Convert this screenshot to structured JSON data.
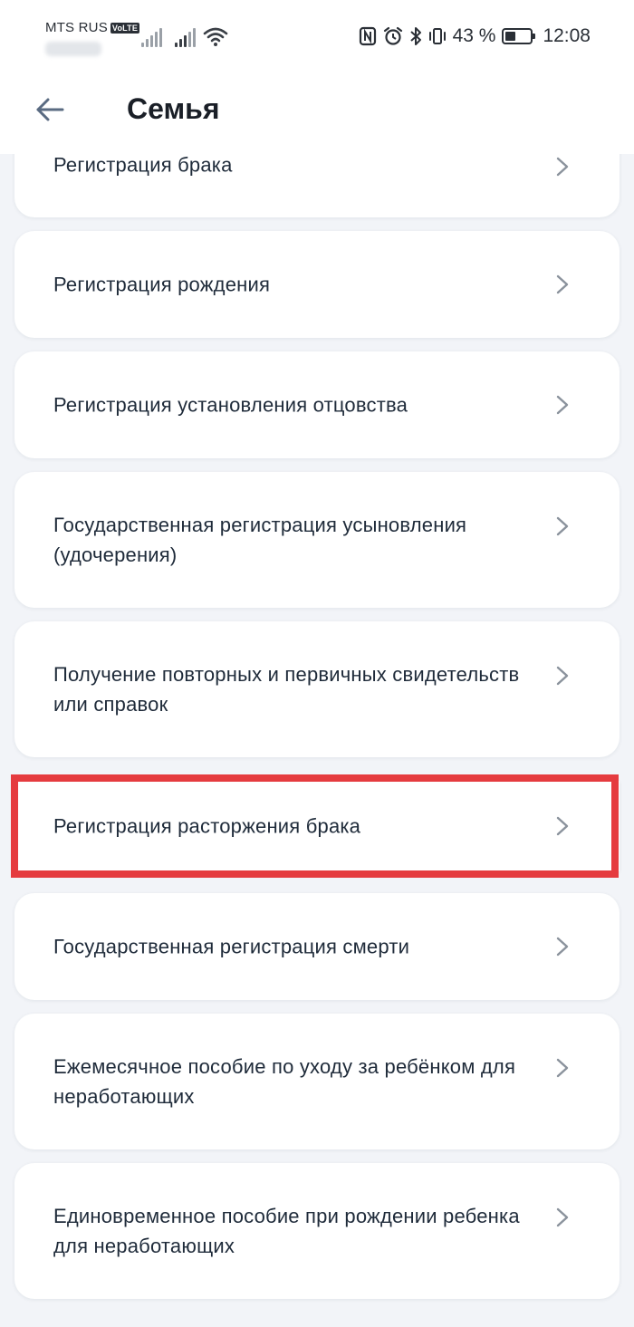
{
  "status_bar": {
    "carrier": "MTS RUS",
    "volte": "VoLTE",
    "battery_text": "43 %",
    "battery_level": 0.43,
    "time": "12:08",
    "icons": [
      "signal-icon",
      "signal-icon",
      "wifi-icon",
      "nfc-icon",
      "alarm-icon",
      "bluetooth-icon",
      "vibrate-icon",
      "battery-icon"
    ]
  },
  "header": {
    "title": "Семья",
    "back_icon": "arrow-left-icon"
  },
  "items": [
    {
      "label": "Регистрация брака"
    },
    {
      "label": "Регистрация рождения"
    },
    {
      "label": "Регистрация установления отцовства"
    },
    {
      "label": "Государственная регистрация усыновления (удочерения)"
    },
    {
      "label": "Получение повторных и первичных свидетельств или справок"
    },
    {
      "label": "Регистрация расторжения брака",
      "highlighted": true
    },
    {
      "label": "Государственная регистрация смерти"
    },
    {
      "label": "Ежемесячное пособие по уходу за ребёнком для неработающих"
    },
    {
      "label": "Единовременное пособие при рождении ребенка для неработающих"
    }
  ],
  "colors": {
    "background": "#f2f4f8",
    "card": "#ffffff",
    "text": "#1f2b3a",
    "chevron": "#8a929c",
    "highlight": "#e53b3f",
    "back_arrow": "#5a6b82"
  }
}
